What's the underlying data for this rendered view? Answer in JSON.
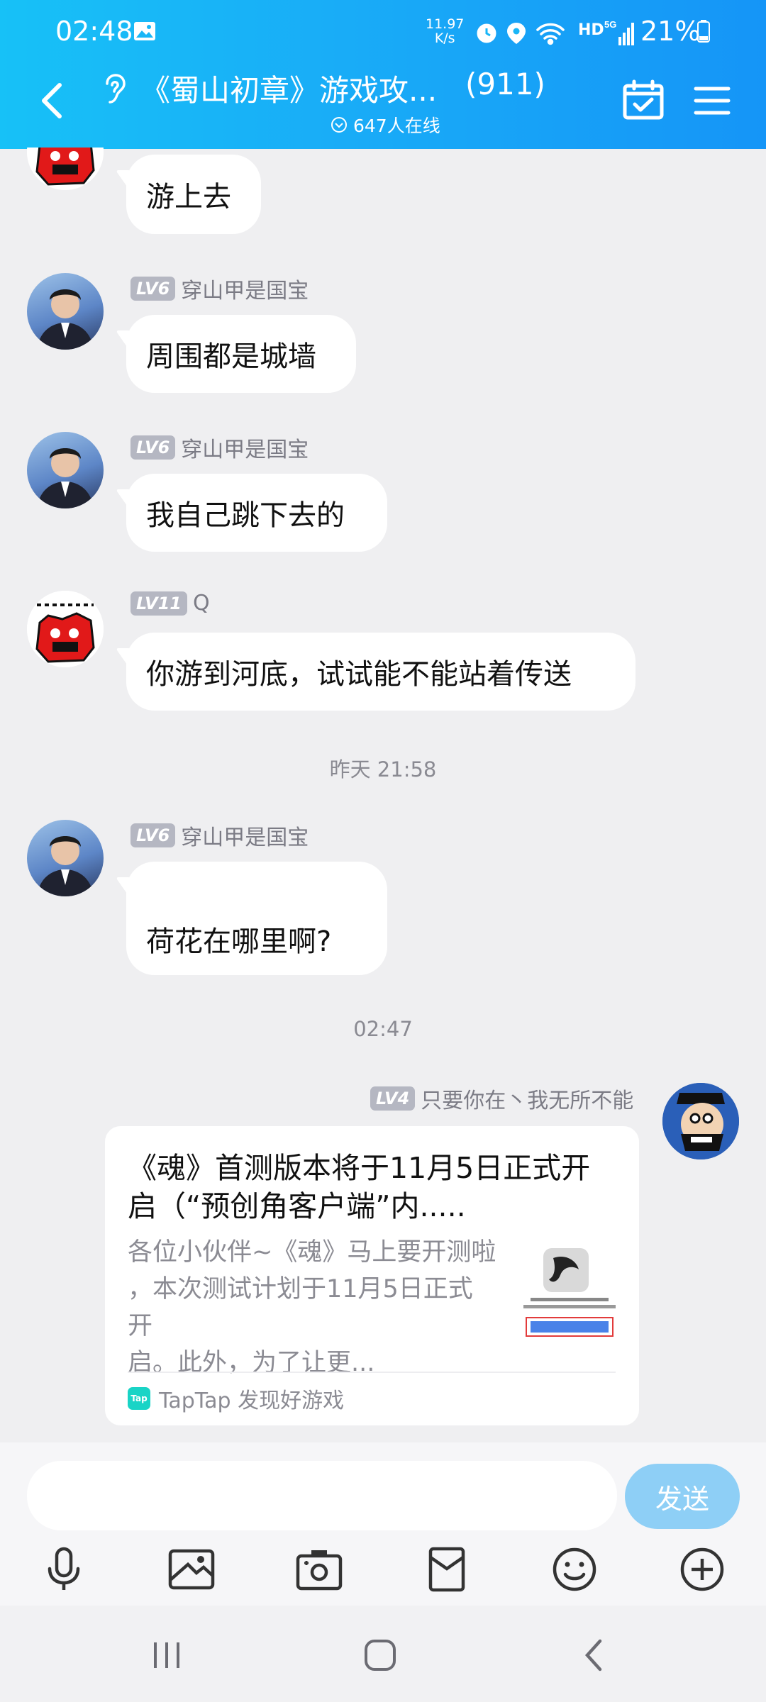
{
  "status_bar": {
    "time": "02:48",
    "net_speed_value": "11.97",
    "net_speed_unit": "K/s",
    "network": "HD",
    "battery": "21%"
  },
  "header": {
    "title": "《蜀山初章》游戏攻...",
    "member_count": "(911)",
    "online": "647人在线",
    "accent_color": "#19acf7"
  },
  "messages": [
    {
      "text": "游上去"
    },
    {
      "level": "LV6",
      "name": "穿山甲是国宝",
      "text": "周围都是城墙"
    },
    {
      "level": "LV6",
      "name": "穿山甲是国宝",
      "text": "我自己跳下去的"
    },
    {
      "level": "LV11",
      "name": "Q",
      "text": "你游到河底，试试能不能站着传送"
    },
    {
      "level": "LV6",
      "name": "穿山甲是国宝",
      "text": "荷花在哪里啊?"
    }
  ],
  "timestamps": [
    "昨天 21:58",
    "02:47"
  ],
  "self_message": {
    "level": "LV4",
    "name": "只要你在丶我无所不能",
    "card": {
      "title_line1": "《魂》首测版本将于11月5日正式开",
      "title_line2": "启（“预创角客户端”内.....",
      "desc_line1": "各位小伙伴~《魂》马上要开测啦",
      "desc_line2": "，本次测试计划于11月5日正式开",
      "desc_line3": "启。此外，为了让更...",
      "source": "TapTap 发现好游戏",
      "source_logo": "Tap"
    }
  },
  "input": {
    "placeholder": "",
    "send_label": "发送"
  },
  "toolbar_icons": [
    "microphone-icon",
    "image-icon",
    "camera-icon",
    "red-packet-icon",
    "emoji-icon",
    "plus-icon"
  ],
  "nav_icons": [
    "recents-icon",
    "home-icon",
    "back-icon"
  ]
}
